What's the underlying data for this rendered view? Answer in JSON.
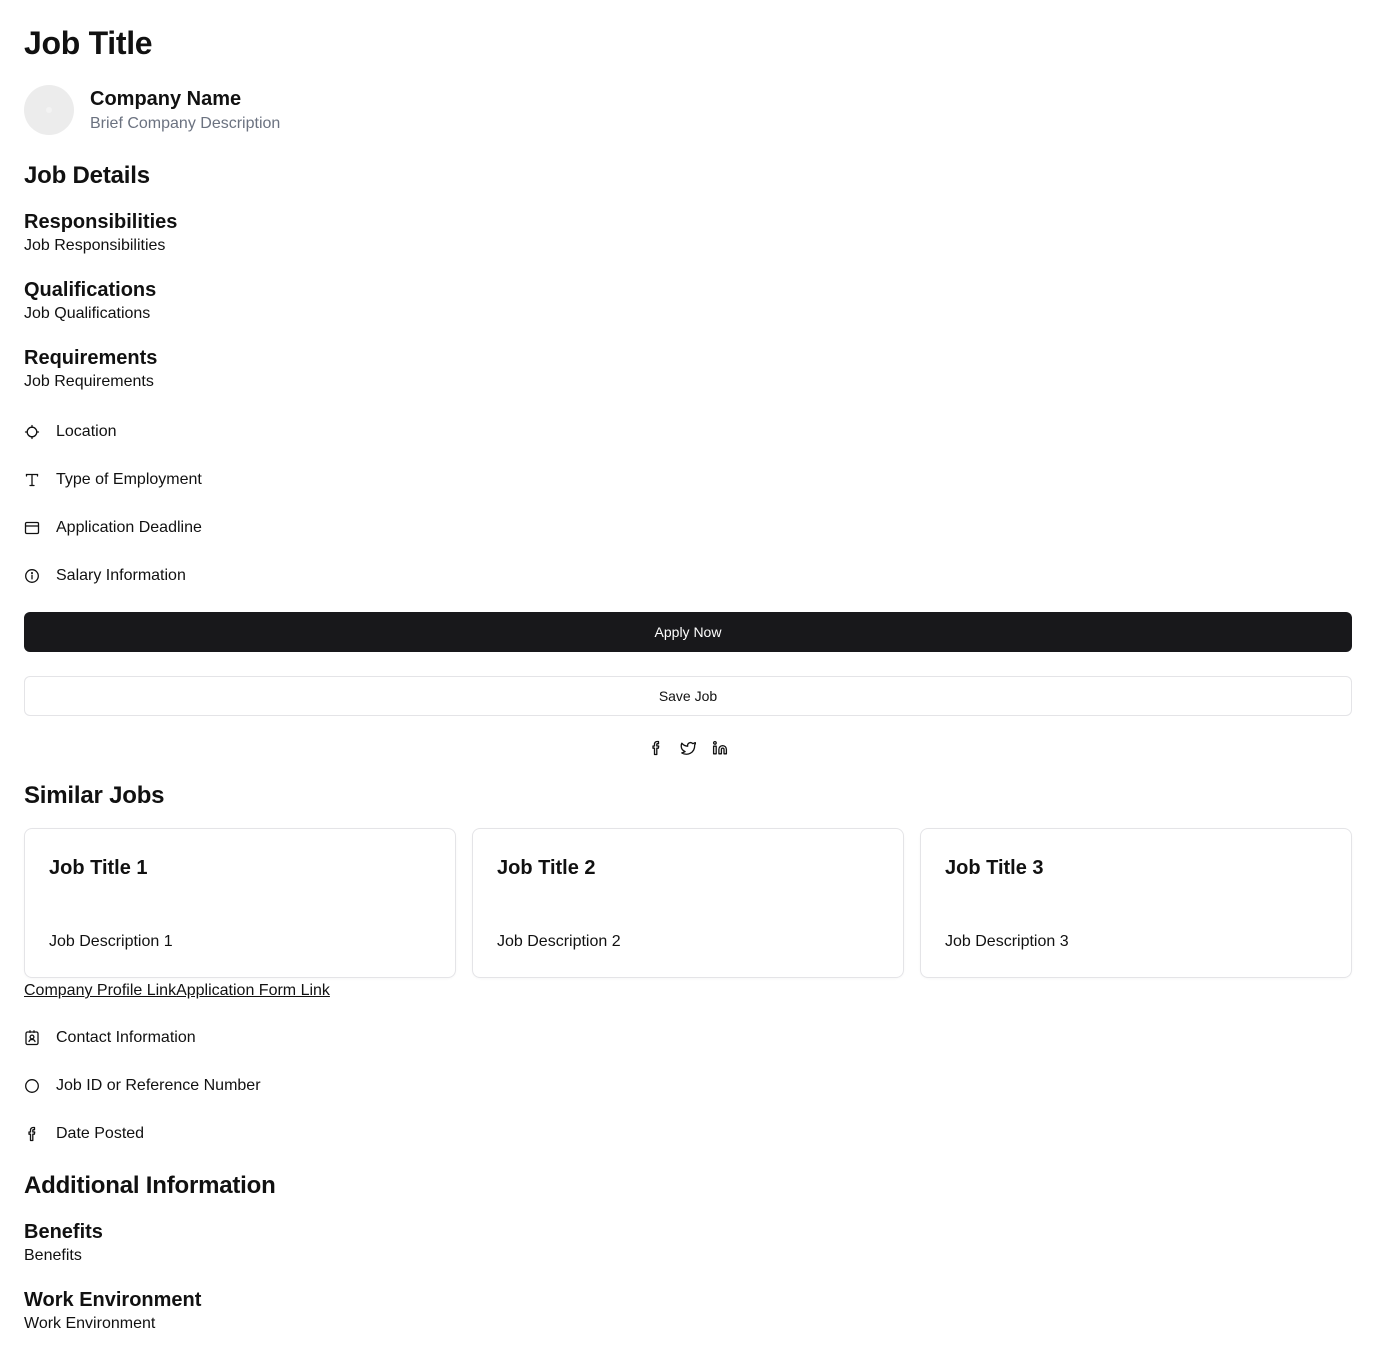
{
  "header": {
    "title": "Job Title",
    "company_name": "Company Name",
    "company_description": "Brief Company Description"
  },
  "job_details": {
    "heading": "Job Details",
    "sections": [
      {
        "title": "Responsibilities",
        "text": "Job Responsibilities"
      },
      {
        "title": "Qualifications",
        "text": "Job Qualifications"
      },
      {
        "title": "Requirements",
        "text": "Job Requirements"
      }
    ],
    "info": [
      {
        "icon": "crosshair-icon",
        "label": "Location"
      },
      {
        "icon": "type-icon",
        "label": "Type of Employment"
      },
      {
        "icon": "calendar-icon",
        "label": "Application Deadline"
      },
      {
        "icon": "info-icon",
        "label": "Salary Information"
      }
    ]
  },
  "actions": {
    "apply_label": "Apply Now",
    "save_label": "Save Job"
  },
  "social": [
    "facebook-icon",
    "twitter-icon",
    "linkedin-icon"
  ],
  "similar_jobs": {
    "heading": "Similar Jobs",
    "items": [
      {
        "title": "Job Title 1",
        "description": "Job Description 1"
      },
      {
        "title": "Job Title 2",
        "description": "Job Description 2"
      },
      {
        "title": "Job Title 3",
        "description": "Job Description 3"
      }
    ]
  },
  "links": {
    "company_profile": "Company Profile Link",
    "application_form": "Application Form Link"
  },
  "meta_info": [
    {
      "icon": "contact-icon",
      "label": "Contact Information"
    },
    {
      "icon": "circle-icon",
      "label": "Job ID or Reference Number"
    },
    {
      "icon": "facebook-icon",
      "label": "Date Posted"
    }
  ],
  "additional": {
    "heading": "Additional Information",
    "sections": [
      {
        "title": "Benefits",
        "text": "Benefits"
      },
      {
        "title": "Work Environment",
        "text": "Work Environment"
      }
    ]
  }
}
